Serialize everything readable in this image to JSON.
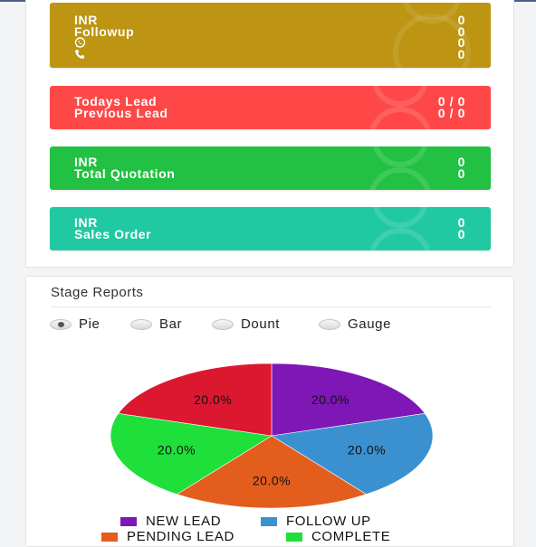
{
  "dashboard": {
    "inr_card": {
      "color": "#bd9512",
      "rows": [
        {
          "label": "INR",
          "value": "0"
        },
        {
          "label": "Followup",
          "value": "0"
        },
        {
          "icon": "whatsapp-icon",
          "value": "0"
        },
        {
          "icon": "phone-icon",
          "value": "0"
        }
      ]
    },
    "lead_card": {
      "color": "#fe4848",
      "rows": [
        {
          "label": "Todays Lead",
          "value": "0 / 0"
        },
        {
          "label": "Previous Lead",
          "value": "0 / 0"
        }
      ]
    },
    "quotation_card": {
      "color": "#22c143",
      "rows": [
        {
          "label": "INR",
          "value": "0"
        },
        {
          "label": "Total Quotation",
          "value": "0"
        }
      ]
    },
    "sales_card": {
      "color": "#20c9a2",
      "rows": [
        {
          "label": "INR",
          "value": "0"
        },
        {
          "label": "Sales Order",
          "value": "0"
        }
      ]
    }
  },
  "stage_reports": {
    "title": "Stage Reports",
    "chart_types": [
      {
        "label": "Pie",
        "selected": true
      },
      {
        "label": "Bar",
        "selected": false
      },
      {
        "label": "Dount",
        "selected": false
      },
      {
        "label": "Gauge",
        "selected": false
      }
    ]
  },
  "chart_data": {
    "type": "pie",
    "categories": [
      "NEW LEAD",
      "FOLLOW UP",
      "PENDING LEAD",
      "COMPLETE"
    ],
    "slices": [
      {
        "label": "NEW LEAD",
        "percent": "20.0%",
        "value": 20.0,
        "color": "#7f16b6"
      },
      {
        "label": "FOLLOW UP",
        "percent": "20.0%",
        "value": 20.0,
        "color": "#3b91d0"
      },
      {
        "label": "PENDING LEAD",
        "percent": "20.0%",
        "value": 20.0,
        "color": "#e35d1d"
      },
      {
        "label": "COMPLETE",
        "percent": "20.0%",
        "value": 20.0,
        "color": "#1fdf3b"
      },
      {
        "label": "",
        "percent": "20.0%",
        "value": 20.0,
        "color": "#db1830"
      }
    ],
    "legend": [
      {
        "label": "NEW LEAD",
        "color": "#7f16b6"
      },
      {
        "label": "FOLLOW UP",
        "color": "#3b91d0"
      },
      {
        "label": "PENDING LEAD",
        "color": "#e35d1d"
      },
      {
        "label": "COMPLETE",
        "color": "#1fdf3b"
      }
    ],
    "legend_position": "bottom"
  }
}
